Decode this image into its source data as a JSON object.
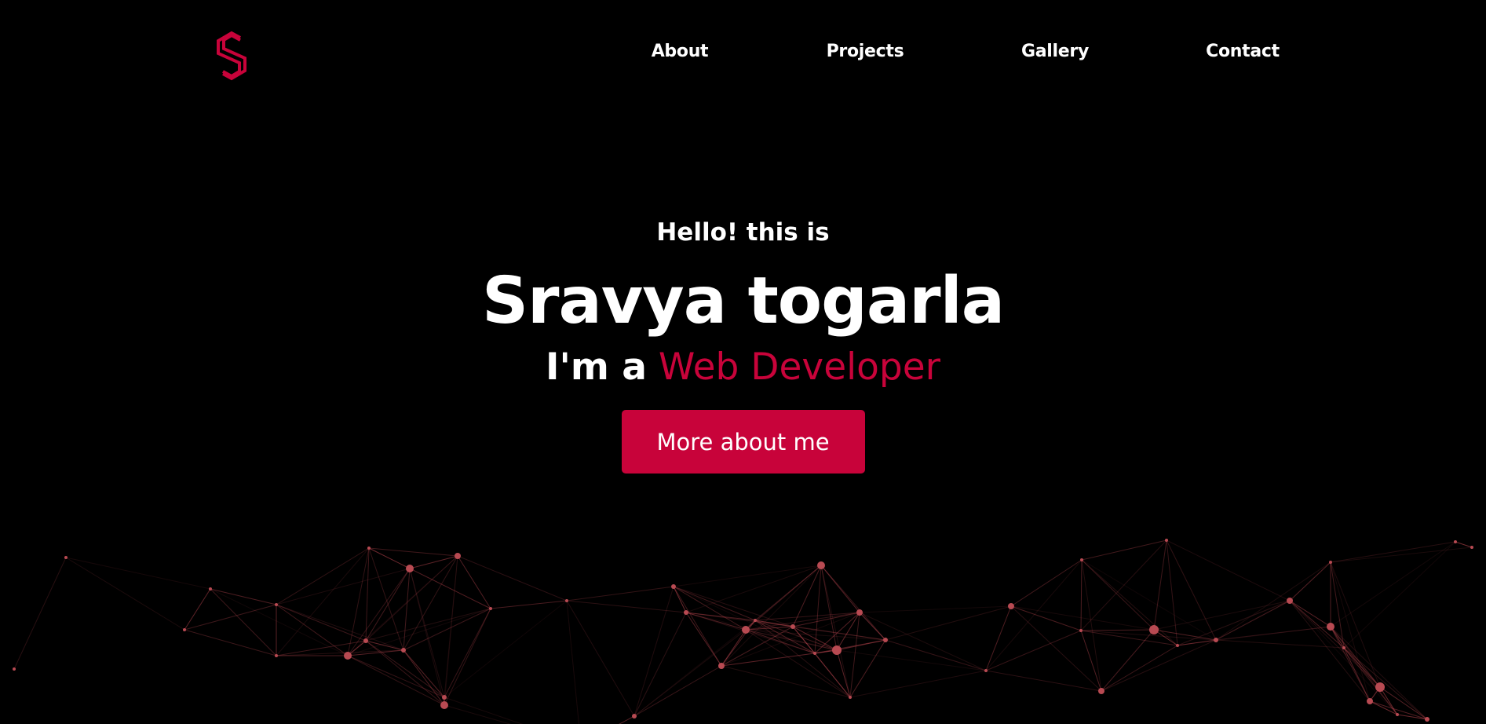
{
  "brand": {
    "accent_color": "#c8033a",
    "background_color": "#000000",
    "logo_icon": "s-hexagon-logo-icon"
  },
  "nav": {
    "items": [
      {
        "label": "About"
      },
      {
        "label": "Projects"
      },
      {
        "label": "Gallery"
      },
      {
        "label": "Contact"
      }
    ]
  },
  "hero": {
    "greeting": "Hello! this is",
    "name": "Sravya togarla",
    "role_prefix": "I'm a",
    "role_highlight": "Web Developer",
    "cta_label": "More about me"
  },
  "background": {
    "effect": "particle-network",
    "line_color": "#c84b55",
    "node_color": "#b84a52"
  }
}
